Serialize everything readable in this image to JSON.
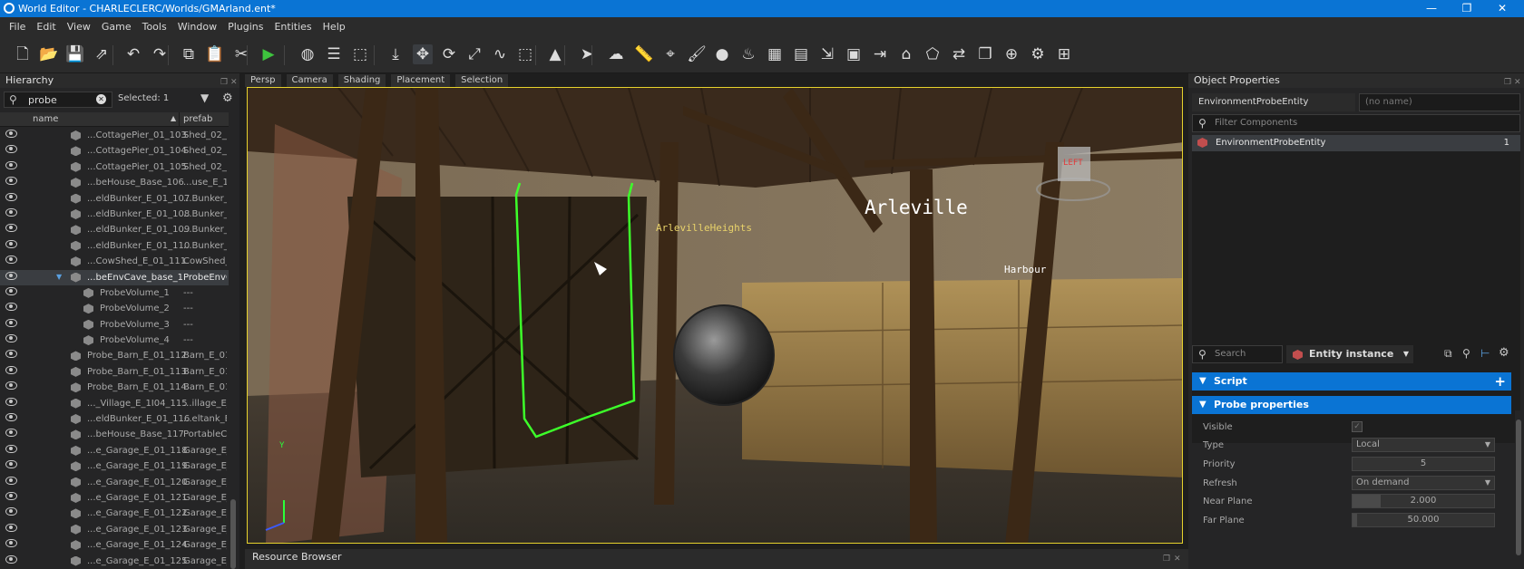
{
  "window": {
    "title": "World Editor - CHARLECLERC/Worlds/GMArland.ent*",
    "controls": [
      "—",
      "❐",
      "✕"
    ]
  },
  "menu": [
    "File",
    "Edit",
    "View",
    "Game",
    "Tools",
    "Window",
    "Plugins",
    "Entities",
    "Help"
  ],
  "toolbar_icons": [
    "new-file",
    "open-folder",
    "save",
    "export",
    "undo",
    "redo",
    "copy",
    "paste",
    "cut",
    "play",
    "globe",
    "layers",
    "select-region",
    "snap",
    "move",
    "rotate",
    "scale",
    "curve",
    "bounding-box",
    "terrain",
    "cursor-arrow",
    "weather",
    "ruler",
    "map-pin",
    "brush",
    "sphere",
    "fire",
    "grid",
    "boxes",
    "import",
    "prefab",
    "send",
    "hat",
    "transform",
    "swap",
    "duplicate",
    "world",
    "settings",
    "hierarchy"
  ],
  "hierarchy": {
    "title": "Hierarchy",
    "search": "probe",
    "selected": "Selected: 1",
    "col_name": "name",
    "col_prefab": "prefab",
    "rows": [
      {
        "name": "...CottagePier_01_103",
        "prefab": "Shed_02_sm",
        "indent": 1
      },
      {
        "name": "...CottagePier_01_104",
        "prefab": "Shed_02_sm",
        "indent": 1
      },
      {
        "name": "...CottagePier_01_105",
        "prefab": "Shed_02_sm",
        "indent": 1
      },
      {
        "name": "...beHouse_Base_106",
        "prefab": "...use_E_1L",
        "indent": 1
      },
      {
        "name": "...eldBunker_E_01_107",
        "prefab": "...Bunker_E",
        "indent": 1
      },
      {
        "name": "...eldBunker_E_01_108",
        "prefab": "...Bunker_E",
        "indent": 1
      },
      {
        "name": "...eldBunker_E_01_109",
        "prefab": "...Bunker_E",
        "indent": 1
      },
      {
        "name": "...eldBunker_E_01_110",
        "prefab": "...Bunker_E",
        "indent": 1
      },
      {
        "name": "...CowShed_E_01_111",
        "prefab": "CowShed_",
        "indent": 1
      },
      {
        "name": "...beEnvCave_base_1",
        "prefab": "ProbeEnvC",
        "indent": 1,
        "selected": true,
        "expanded": true
      },
      {
        "name": "ProbeVolume_1",
        "prefab": "---",
        "indent": 2
      },
      {
        "name": "ProbeVolume_2",
        "prefab": "---",
        "indent": 2
      },
      {
        "name": "ProbeVolume_3",
        "prefab": "---",
        "indent": 2
      },
      {
        "name": "ProbeVolume_4",
        "prefab": "---",
        "indent": 2
      },
      {
        "name": "Probe_Barn_E_01_112",
        "prefab": "Barn_E_01",
        "indent": 1
      },
      {
        "name": "Probe_Barn_E_01_113",
        "prefab": "Barn_E_01",
        "indent": 1
      },
      {
        "name": "Probe_Barn_E_01_114",
        "prefab": "Barn_E_01",
        "indent": 1
      },
      {
        "name": "..._Village_E_1I04_115",
        "prefab": "...illage_E_",
        "indent": 1
      },
      {
        "name": "...eldBunker_E_01_116",
        "prefab": "...eltank_E",
        "indent": 1
      },
      {
        "name": "...beHouse_Base_117",
        "prefab": "PortableCa",
        "indent": 1
      },
      {
        "name": "...e_Garage_E_01_118",
        "prefab": "Garage_E_0",
        "indent": 1
      },
      {
        "name": "...e_Garage_E_01_119",
        "prefab": "Garage_E_0",
        "indent": 1
      },
      {
        "name": "...e_Garage_E_01_120",
        "prefab": "Garage_E_0",
        "indent": 1
      },
      {
        "name": "...e_Garage_E_01_121",
        "prefab": "Garage_E_0",
        "indent": 1
      },
      {
        "name": "...e_Garage_E_01_122",
        "prefab": "Garage_E_0",
        "indent": 1
      },
      {
        "name": "...e_Garage_E_01_123",
        "prefab": "Garage_E_0",
        "indent": 1
      },
      {
        "name": "...e_Garage_E_01_124",
        "prefab": "Garage_E_0",
        "indent": 1
      },
      {
        "name": "...e_Garage_E_01_125",
        "prefab": "Garage_E_0",
        "indent": 1
      }
    ]
  },
  "viewport": {
    "tabs": [
      "Persp",
      "Camera",
      "Shading",
      "Placement",
      "Selection"
    ],
    "labels": {
      "town": "Arleville",
      "heights": "ArlevilleHeights",
      "harbour": "Harbour",
      "gizmo": "LEFT",
      "axis_y": "Y"
    },
    "selection_color": "#3dff2a",
    "border_color": "#e6d22c"
  },
  "resource_browser": {
    "title": "Resource Browser"
  },
  "object_properties": {
    "title": "Object Properties",
    "entity_class": "EnvironmentProbeEntity",
    "name_placeholder": "(no name)",
    "filter_placeholder": "Filter Components",
    "component": {
      "name": "EnvironmentProbeEntity",
      "count": "1"
    },
    "search_placeholder": "Search",
    "instance_mode": "Entity instance",
    "sections": {
      "script": "Script",
      "probe": "Probe properties"
    },
    "props": [
      {
        "label": "Visible",
        "kind": "check",
        "value": "✓"
      },
      {
        "label": "Type",
        "kind": "select",
        "value": "Local"
      },
      {
        "label": "Priority",
        "kind": "num",
        "value": "5",
        "level": 0.0
      },
      {
        "label": "Refresh",
        "kind": "select",
        "value": "On demand"
      },
      {
        "label": "Near Plane",
        "kind": "num",
        "value": "2.000",
        "level": 0.2
      },
      {
        "label": "Far Plane",
        "kind": "num",
        "value": "50.000",
        "level": 0.03
      }
    ]
  },
  "accent": "#0a74d4"
}
